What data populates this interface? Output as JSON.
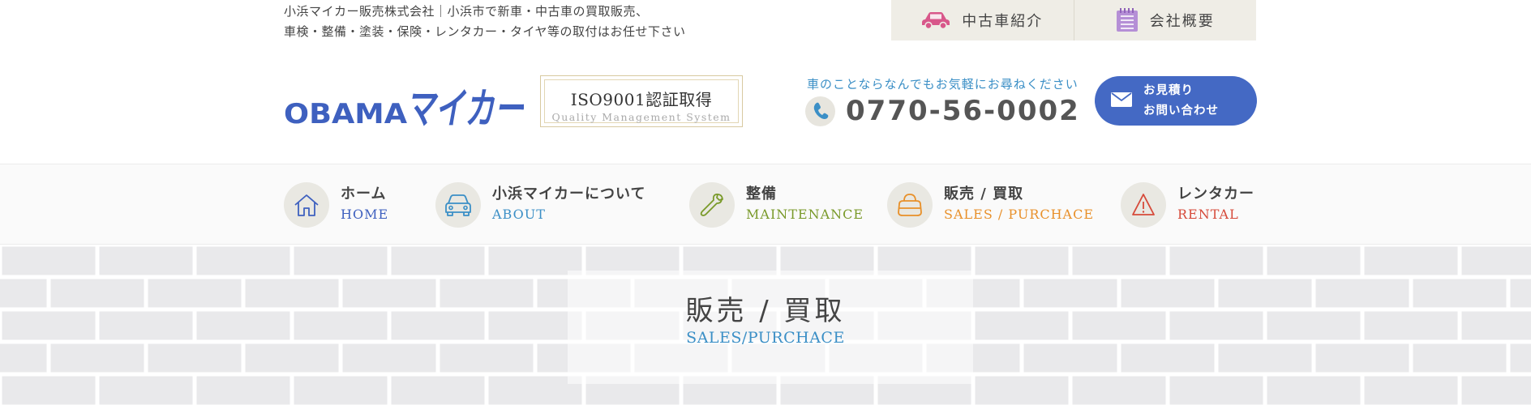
{
  "header": {
    "tagline_line1": "小浜マイカー販売株式会社｜小浜市で新車・中古車の買取販売、",
    "tagline_line2": "車検・整備・塗装・保険・レンタカー・タイヤ等の取付はお任せ下さい",
    "top_links": [
      {
        "label": "中古車紹介",
        "icon": "car-icon",
        "color": "#d8578a"
      },
      {
        "label": "会社概要",
        "icon": "notepad-icon",
        "color": "#a678c8"
      }
    ],
    "iso_title": "ISO9001認証取得",
    "iso_subtitle": "Quality Management System",
    "contact_lead": "車のことならなんでもお気軽にお尋ねください",
    "phone": "0770-56-0002",
    "estimate_line1": "お見積り",
    "estimate_line2": "お問い合わせ"
  },
  "logo": {
    "text_latin": "OBAMA",
    "text_kana": "マイカー",
    "color": "#3e60bf"
  },
  "nav": {
    "items": [
      {
        "jp": "ホーム",
        "en": "HOME",
        "icon": "house-icon",
        "color": "#3e60bf"
      },
      {
        "jp": "小浜マイカーについて",
        "en": "ABOUT",
        "icon": "car-front-icon",
        "color": "#3b8fc6"
      },
      {
        "jp": "整備",
        "en": "MAINTENANCE",
        "icon": "wrench-icon",
        "color": "#7a9a2a"
      },
      {
        "jp": "販売 / 買取",
        "en": "SALES / PURCHACE",
        "icon": "purse-icon",
        "color": "#e8902a"
      },
      {
        "jp": "レンタカー",
        "en": "RENTAL",
        "icon": "warning-cone-icon",
        "color": "#d64a3a"
      }
    ]
  },
  "hero": {
    "title": "販売 / 買取",
    "subtitle": "SALES/PURCHACE"
  }
}
